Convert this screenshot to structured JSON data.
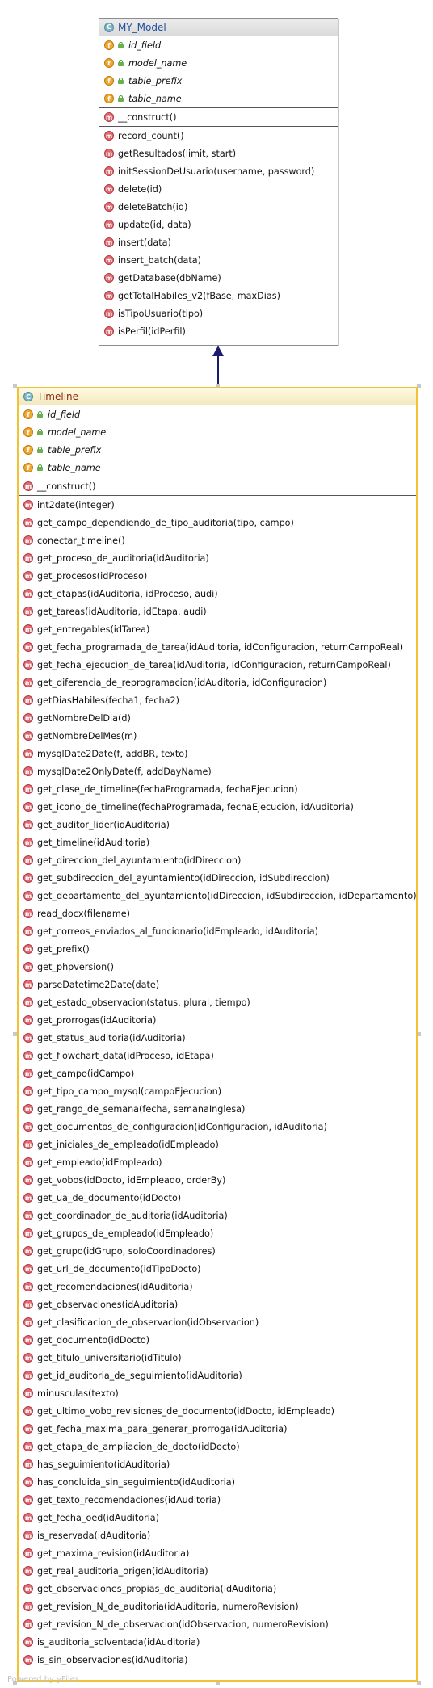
{
  "model_class": {
    "name": "MY_Model",
    "icon": "class-icon",
    "fields": [
      "id_field",
      "model_name",
      "table_prefix",
      "table_name"
    ],
    "constructors": [
      "__construct()"
    ],
    "methods": [
      "record_count()",
      "getResultados(limit, start)",
      "initSessionDeUsuario(username, password)",
      "delete(id)",
      "deleteBatch(id)",
      "update(id, data)",
      "insert(data)",
      "insert_batch(data)",
      "getDatabase(dbName)",
      "getTotalHabiles_v2(fBase, maxDias)",
      "isTipoUsuario(tipo)",
      "isPerfil(idPerfil)"
    ]
  },
  "timeline_class": {
    "name": "Timeline",
    "icon": "class-icon",
    "fields": [
      "id_field",
      "model_name",
      "table_prefix",
      "table_name"
    ],
    "constructors": [
      "__construct()"
    ],
    "methods": [
      "int2date(integer)",
      "get_campo_dependiendo_de_tipo_auditoria(tipo, campo)",
      "conectar_timeline()",
      "get_proceso_de_auditoria(idAuditoria)",
      "get_procesos(idProceso)",
      "get_etapas(idAuditoria, idProceso, audi)",
      "get_tareas(idAuditoria, idEtapa, audi)",
      "get_entregables(idTarea)",
      "get_fecha_programada_de_tarea(idAuditoria, idConfiguracion, returnCampoReal)",
      "get_fecha_ejecucion_de_tarea(idAuditoria, idConfiguracion, returnCampoReal)",
      "get_diferencia_de_reprogramacion(idAuditoria, idConfiguracion)",
      "getDiasHabiles(fecha1, fecha2)",
      "getNombreDelDia(d)",
      "getNombreDelMes(m)",
      "mysqlDate2Date(f, addBR, texto)",
      "mysqlDate2OnlyDate(f, addDayName)",
      "get_clase_de_timeline(fechaProgramada, fechaEjecucion)",
      "get_icono_de_timeline(fechaProgramada, fechaEjecucion, idAuditoria)",
      "get_auditor_lider(idAuditoria)",
      "get_timeline(idAuditoria)",
      "get_direccion_del_ayuntamiento(idDireccion)",
      "get_subdireccion_del_ayuntamiento(idDireccion, idSubdireccion)",
      "get_departamento_del_ayuntamiento(idDireccion, idSubdireccion, idDepartamento)",
      "read_docx(filename)",
      "get_correos_enviados_al_funcionario(idEmpleado, idAuditoria)",
      "get_prefix()",
      "get_phpversion()",
      "parseDatetime2Date(date)",
      "get_estado_observacion(status, plural, tiempo)",
      "get_prorrogas(idAuditoria)",
      "get_status_auditoria(idAuditoria)",
      "get_flowchart_data(idProceso, idEtapa)",
      "get_campo(idCampo)",
      "get_tipo_campo_mysql(campoEjecucion)",
      "get_rango_de_semana(fecha, semanaInglesa)",
      "get_documentos_de_configuracion(idConfiguracion, idAuditoria)",
      "get_iniciales_de_empleado(idEmpleado)",
      "get_empleado(idEmpleado)",
      "get_vobos(idDocto, idEmpleado, orderBy)",
      "get_ua_de_documento(idDocto)",
      "get_coordinador_de_auditoria(idAuditoria)",
      "get_grupos_de_empleado(idEmpleado)",
      "get_grupo(idGrupo, soloCoordinadores)",
      "get_url_de_documento(idTipoDocto)",
      "get_recomendaciones(idAuditoria)",
      "get_observaciones(idAuditoria)",
      "get_clasificacion_de_observacion(idObservacion)",
      "get_documento(idDocto)",
      "get_titulo_universitario(idTitulo)",
      "get_id_auditoria_de_seguimiento(idAuditoria)",
      "minusculas(texto)",
      "get_ultimo_vobo_revisiones_de_documento(idDocto, idEmpleado)",
      "get_fecha_maxima_para_generar_prorroga(idAuditoria)",
      "get_etapa_de_ampliacion_de_docto(idDocto)",
      "has_seguimiento(idAuditoria)",
      "has_concluida_sin_seguimiento(idAuditoria)",
      "get_texto_recomendaciones(idAuditoria)",
      "get_fecha_oed(idAuditoria)",
      "is_reservada(idAuditoria)",
      "get_maxima_revision(idAuditoria)",
      "get_real_auditoria_origen(idAuditoria)",
      "get_observaciones_propias_de_auditoria(idAuditoria)",
      "get_revision_N_de_auditoria(idAuditoria, numeroRevision)",
      "get_revision_N_de_observacion(idObservacion, numeroRevision)",
      "is_auditoria_solventada(idAuditoria)",
      "is_sin_observaciones(idAuditoria)"
    ]
  },
  "relation": {
    "type": "inheritance",
    "icon": "generalization-arrow"
  },
  "icon_letters": {
    "class": "C",
    "field": "f",
    "method": "m"
  },
  "footer": "Powered by yFiles",
  "colors": {
    "model_border": "#8d8d8d",
    "timeline_border": "#f1c232",
    "field_icon": "#f0a830",
    "method_icon": "#e06b72",
    "arrow": "#1a1a6e"
  }
}
